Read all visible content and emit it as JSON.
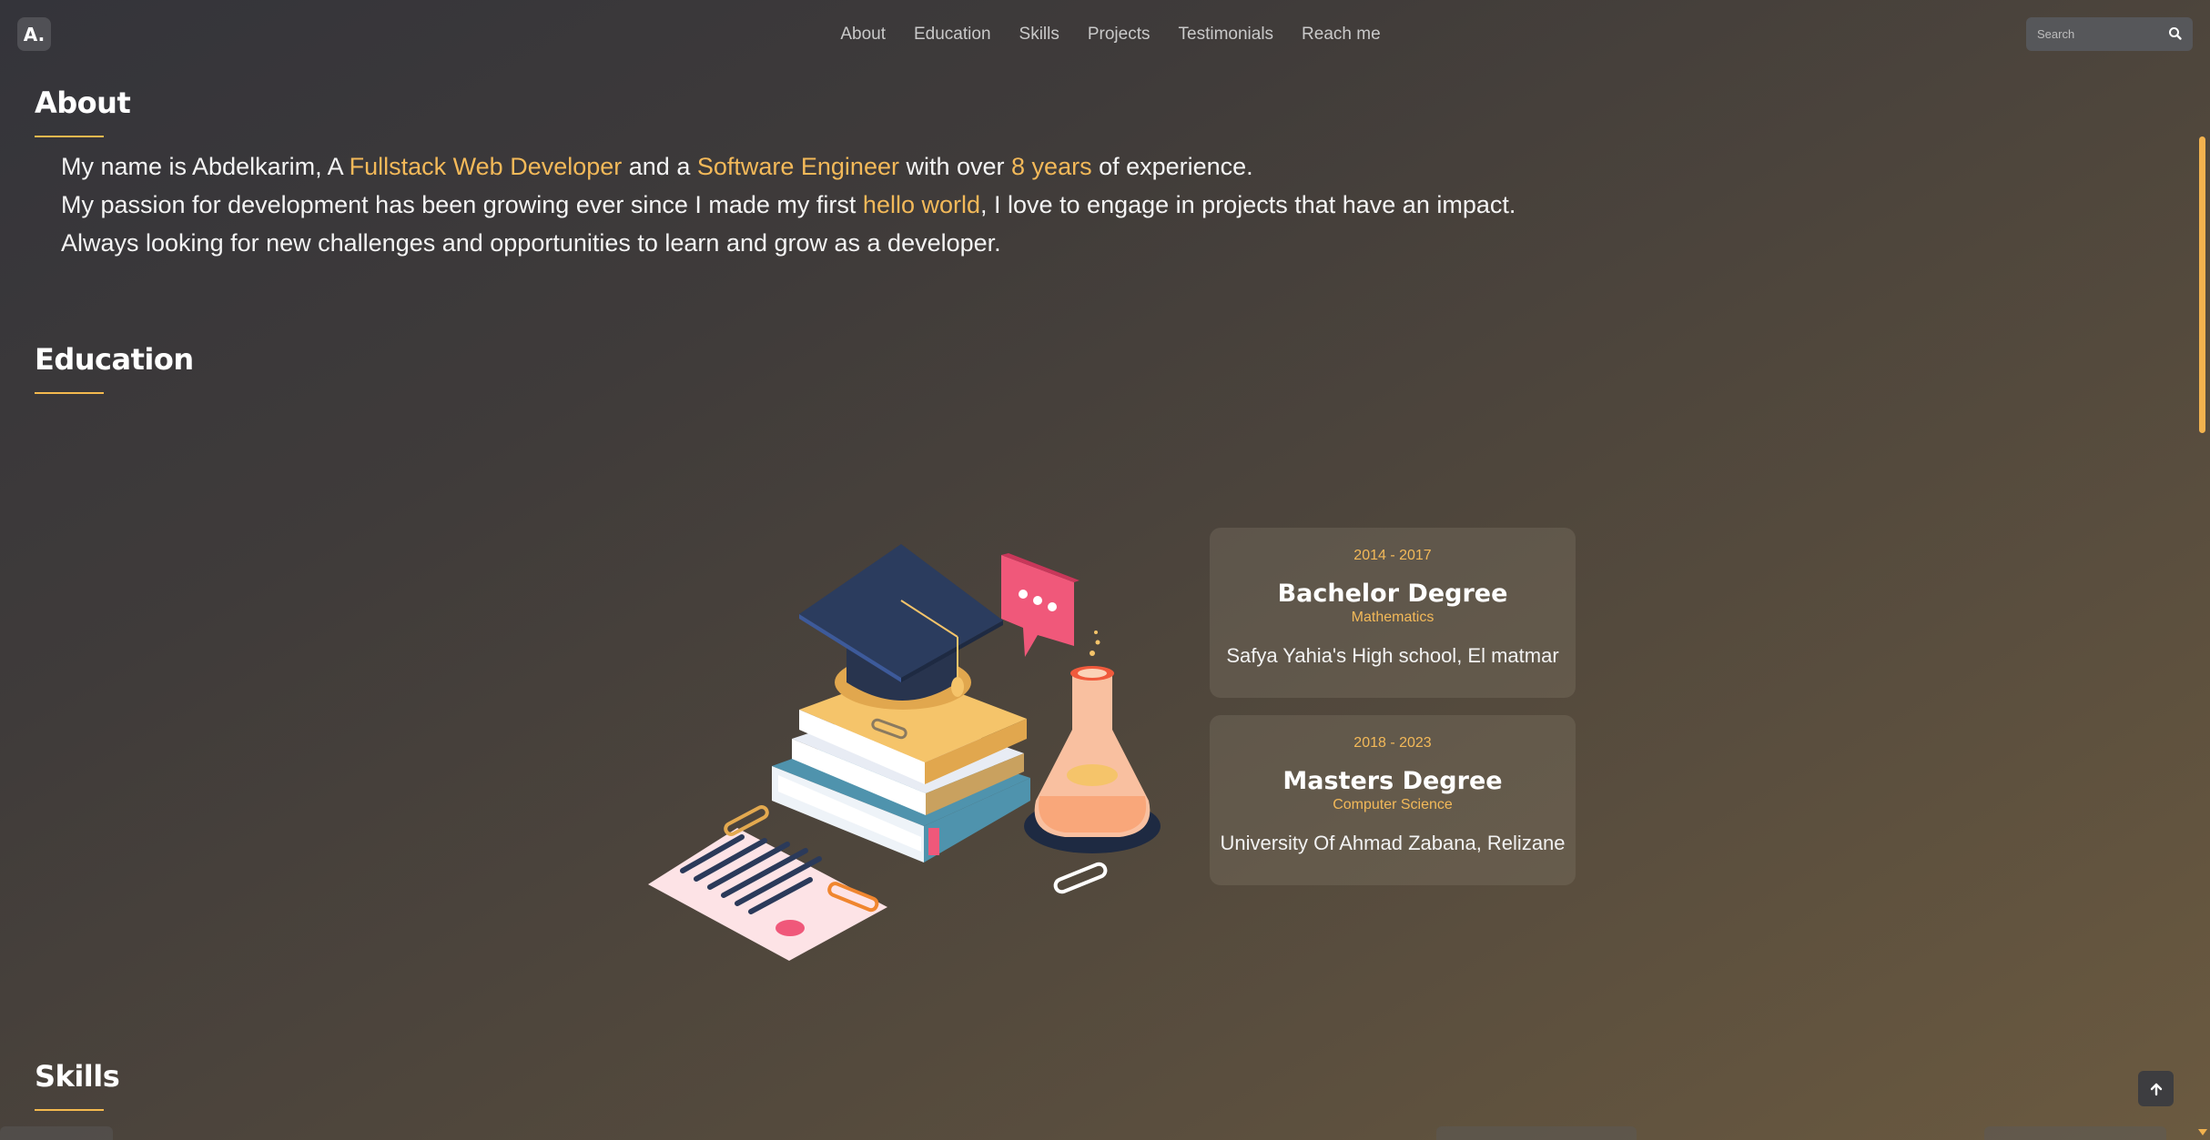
{
  "logo": {
    "text": "A."
  },
  "nav": {
    "items": [
      "About",
      "Education",
      "Skills",
      "Projects",
      "Testimonials",
      "Reach me"
    ]
  },
  "search": {
    "placeholder": "Search"
  },
  "about": {
    "title": "About",
    "line1": {
      "p1": "My name is Abdelkarim, A ",
      "h1": "Fullstack Web Developer",
      "p2": " and a ",
      "h2": "Software Engineer",
      "p3": " with over ",
      "h3": "8 years",
      "p4": " of experience."
    },
    "line2": {
      "p1": "My passion for development has been growing ever since I made my first ",
      "h1": "hello world",
      "p2": ", I love to engage in projects that have an impact."
    },
    "line3": "Always looking for new challenges and opportunities to learn and grow as a developer."
  },
  "education": {
    "title": "Education",
    "cards": [
      {
        "years": "2014 - 2017",
        "degree": "Bachelor Degree",
        "field": "Mathematics",
        "school": "Safya Yahia's High school, El matmar"
      },
      {
        "years": "2018 - 2023",
        "degree": "Masters Degree",
        "field": "Computer Science",
        "school": "University Of Ahmad Zabana, Relizane"
      }
    ]
  },
  "skills": {
    "title": "Skills"
  },
  "colors": {
    "accent": "#f3b959",
    "heading": "#ffffff"
  },
  "icons": [
    "search-icon",
    "arrow-up-icon",
    "education-illustration"
  ]
}
